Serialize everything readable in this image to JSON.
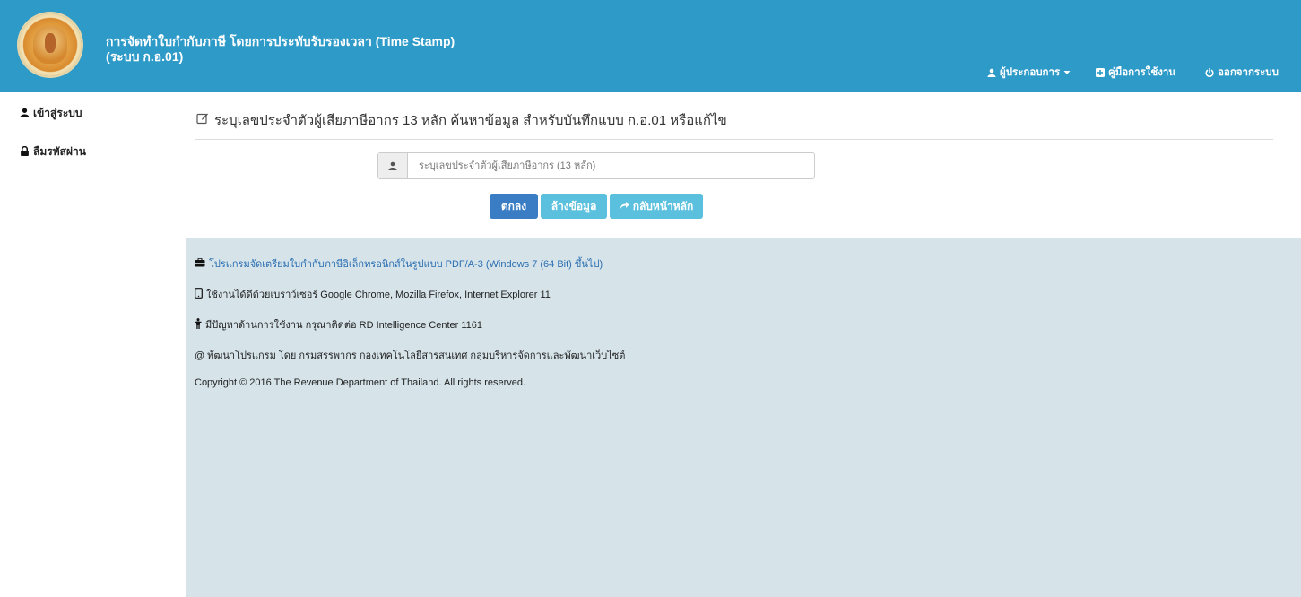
{
  "header": {
    "title": "การจัดทำใบกำกับภาษี โดยการประทับรับรองเวลา (Time Stamp)",
    "subtitle": "(ระบบ ก.อ.01)",
    "nav": {
      "operator_label": "ผู้ประกอบการ",
      "manual_label": "คู่มือการใช้งาน",
      "logout_label": "ออกจากระบบ"
    },
    "colors": {
      "background": "#2e9ac8",
      "text": "#ffffff"
    }
  },
  "sidebar": {
    "items": [
      {
        "label": "เข้าสู่ระบบ",
        "icon": "user-icon"
      },
      {
        "label": "ลืมรหัสผ่าน",
        "icon": "lock-icon"
      }
    ]
  },
  "main": {
    "title": "ระบุเลขประจำตัวผู้เสียภาษีอากร 13 หลัก ค้นหาข้อมูล สำหรับบันทึกแบบ ก.อ.01 หรือแก้ไข",
    "search": {
      "placeholder": "ระบุเลขประจำตัวผู้เสียภาษีอากร (13 หลัก)",
      "value": ""
    },
    "buttons": {
      "submit_label": "ตกลง",
      "clear_label": "ล้างข้อมูล",
      "home_label": "กลับหน้าหลัก"
    },
    "colors": {
      "primary": "#3b7dc4",
      "info": "#5bc0de",
      "info_background": "#d6e4ea"
    }
  },
  "info": {
    "download_link": "โปรแกรมจัดเตรียมใบกำกับภาษีอิเล็กทรอนิกส์ในรูปแบบ PDF/A-3 (Windows 7 (64 Bit) ขึ้นไป)",
    "browser_note": "ใช้งานได้ดีด้วยเบราว์เซอร์ Google Chrome, Mozilla Firefox, Internet Explorer 11",
    "help_note": "มีปัญหาด้านการใช้งาน กรุณาติดต่อ RD Intelligence Center 1161",
    "developer_note": "@ พัฒนาโปรแกรม โดย กรมสรรพากร กองเทคโนโลยีสารสนเทศ กลุ่มบริหารจัดการและพัฒนาเว็บไซต์",
    "copyright": "Copyright © 2016 The Revenue Department of Thailand. All rights reserved."
  }
}
